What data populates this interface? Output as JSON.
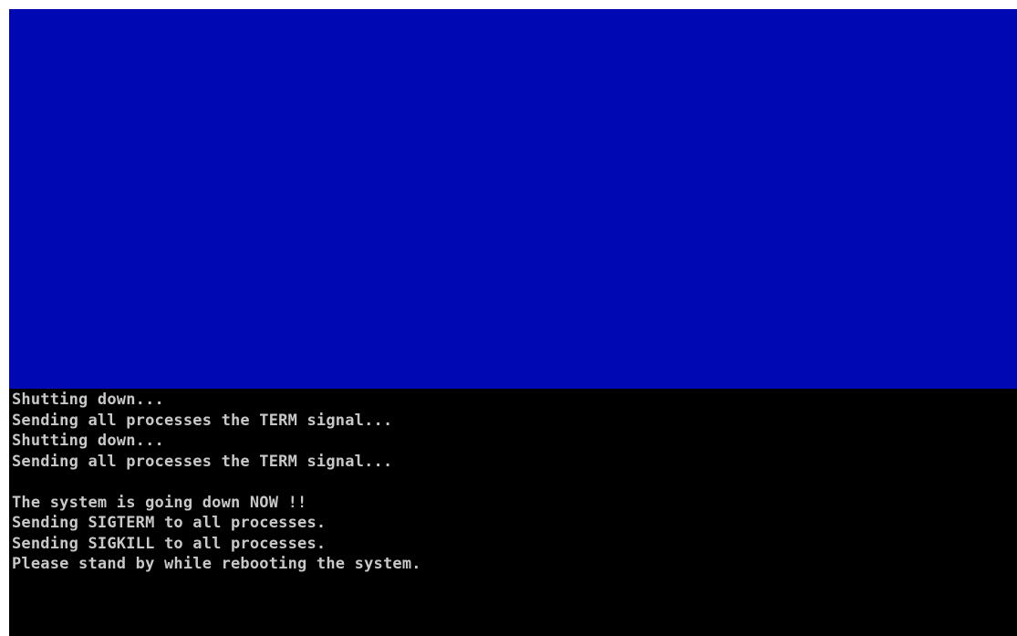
{
  "screen": {
    "colors": {
      "top_panel": "#0008b4",
      "background": "#000000",
      "text": "#c8c8c8"
    },
    "console_lines": [
      "Shutting down...",
      "Sending all processes the TERM signal...",
      "Shutting down...",
      "Sending all processes the TERM signal...",
      "",
      "The system is going down NOW !!",
      "Sending SIGTERM to all processes.",
      "Sending SIGKILL to all processes.",
      "Please stand by while rebooting the system."
    ]
  }
}
